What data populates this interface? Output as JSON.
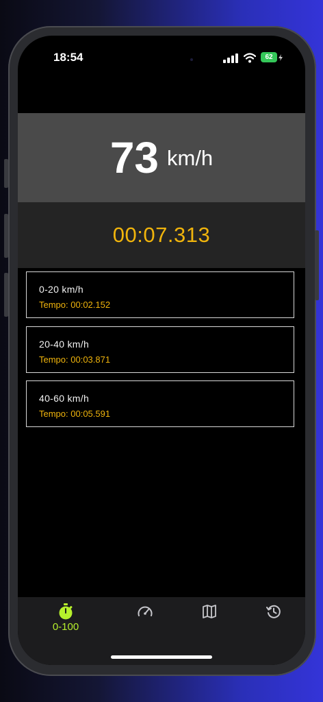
{
  "status_bar": {
    "time": "18:54",
    "battery": "62"
  },
  "speed": {
    "value": "73",
    "unit": "km/h"
  },
  "timer": {
    "elapsed": "00:07.313"
  },
  "splits": [
    {
      "range": "0-20 km/h",
      "time": "Tempo: 00:02.152"
    },
    {
      "range": "20-40 km/h",
      "time": "Tempo: 00:03.871"
    },
    {
      "range": "40-60 km/h",
      "time": "Tempo: 00:05.591"
    }
  ],
  "tabs": [
    {
      "icon": "stopwatch-icon",
      "label": "0-100",
      "active": true
    },
    {
      "icon": "speedometer-icon",
      "label": ""
    },
    {
      "icon": "map-icon",
      "label": ""
    },
    {
      "icon": "history-icon",
      "label": ""
    }
  ],
  "colors": {
    "accent": "#f0b40c",
    "tab_active": "#b6f02c",
    "speed_panel": "#4a4a4a",
    "timer_panel": "#242424",
    "battery": "#34c759"
  }
}
